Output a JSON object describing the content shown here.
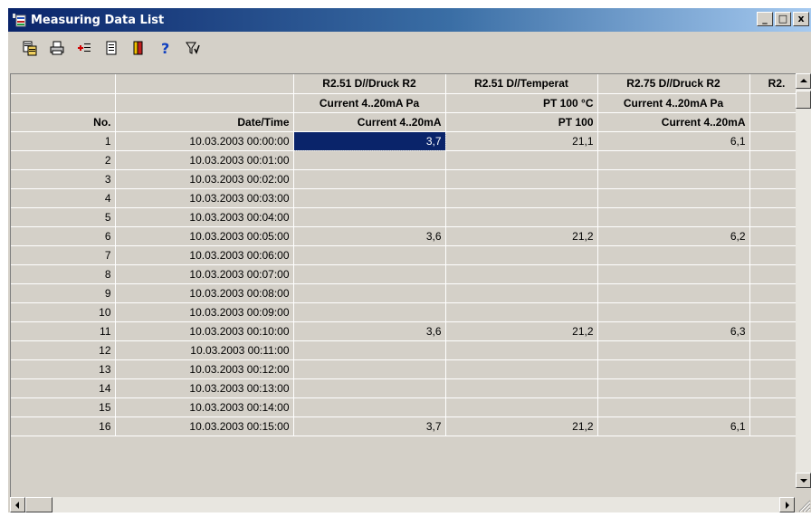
{
  "window": {
    "title": "Measuring Data List",
    "icon": "data-list-app-icon"
  },
  "window_controls": {
    "minimize": "_",
    "maximize": "□",
    "close": "x"
  },
  "toolbar": [
    {
      "name": "copy-data-icon"
    },
    {
      "name": "print-icon"
    },
    {
      "name": "add-channel-icon"
    },
    {
      "name": "document-icon"
    },
    {
      "name": "exit-door-icon"
    },
    {
      "name": "help-icon"
    },
    {
      "name": "filter-icon"
    }
  ],
  "colors": {
    "title_start": "#0a246a",
    "title_end": "#a6caf0",
    "selection": "#0a246a",
    "face": "#d4d0c8"
  },
  "grid": {
    "header_rows": [
      [
        "",
        "",
        "R2.51 D//Druck R2",
        "R2.51 D//Temperat",
        "R2.75 D//Druck R2",
        "R2."
      ],
      [
        "",
        "",
        "Current 4..20mA Pa",
        "PT 100 °C",
        "Current 4..20mA Pa",
        ""
      ],
      [
        "No.",
        "Date/Time",
        "Current 4..20mA",
        "PT 100",
        "Current 4..20mA",
        ""
      ]
    ],
    "rows": [
      [
        "1",
        "10.03.2003 00:00:00",
        "3,7",
        "21,1",
        "6,1",
        ""
      ],
      [
        "2",
        "10.03.2003 00:01:00",
        "",
        "",
        "",
        ""
      ],
      [
        "3",
        "10.03.2003 00:02:00",
        "",
        "",
        "",
        ""
      ],
      [
        "4",
        "10.03.2003 00:03:00",
        "",
        "",
        "",
        ""
      ],
      [
        "5",
        "10.03.2003 00:04:00",
        "",
        "",
        "",
        ""
      ],
      [
        "6",
        "10.03.2003 00:05:00",
        "3,6",
        "21,2",
        "6,2",
        ""
      ],
      [
        "7",
        "10.03.2003 00:06:00",
        "",
        "",
        "",
        ""
      ],
      [
        "8",
        "10.03.2003 00:07:00",
        "",
        "",
        "",
        ""
      ],
      [
        "9",
        "10.03.2003 00:08:00",
        "",
        "",
        "",
        ""
      ],
      [
        "10",
        "10.03.2003 00:09:00",
        "",
        "",
        "",
        ""
      ],
      [
        "11",
        "10.03.2003 00:10:00",
        "3,6",
        "21,2",
        "6,3",
        ""
      ],
      [
        "12",
        "10.03.2003 00:11:00",
        "",
        "",
        "",
        ""
      ],
      [
        "13",
        "10.03.2003 00:12:00",
        "",
        "",
        "",
        ""
      ],
      [
        "14",
        "10.03.2003 00:13:00",
        "",
        "",
        "",
        ""
      ],
      [
        "15",
        "10.03.2003 00:14:00",
        "",
        "",
        "",
        ""
      ],
      [
        "16",
        "10.03.2003 00:15:00",
        "3,7",
        "21,2",
        "6,1",
        ""
      ]
    ],
    "selected_cell": {
      "row": 0,
      "col": 2
    }
  }
}
